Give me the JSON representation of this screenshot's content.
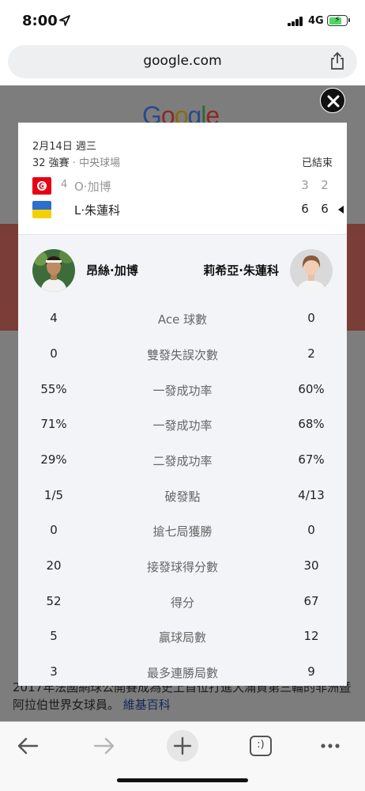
{
  "status_bar": {
    "time": "8:00",
    "network": "4G"
  },
  "browser": {
    "url": "google.com"
  },
  "background_page": {
    "logo": [
      "G",
      "o",
      "o",
      "g",
      "l",
      "e"
    ],
    "snippet_text": "2017年法國網球公開賽成為史上首位打進大滿貫第三輪的非洲暨阿拉伯世界女球員。",
    "snippet_link": "維基百科"
  },
  "match": {
    "date": "2月14日 週三",
    "round": "32 強賽",
    "separator": "·",
    "court": "中央球場",
    "status": "已結束",
    "players": [
      {
        "seed": "4",
        "name": "O·加博",
        "sets": [
          "3",
          "2"
        ],
        "flag": "tunisia",
        "winner": false
      },
      {
        "seed": "",
        "name": "L·朱蓮科",
        "sets": [
          "6",
          "6"
        ],
        "flag": "ukraine",
        "winner": true
      }
    ]
  },
  "stats": {
    "player1_name": "昂絲·加博",
    "player2_name": "莉希亞·朱蓮科",
    "rows": [
      {
        "p1": "4",
        "label": "Ace 球數",
        "p2": "0"
      },
      {
        "p1": "0",
        "label": "雙發失誤次數",
        "p2": "2"
      },
      {
        "p1": "55%",
        "label": "一發成功率",
        "p2": "60%"
      },
      {
        "p1": "71%",
        "label": "一發成功率",
        "p2": "68%"
      },
      {
        "p1": "29%",
        "label": "二發成功率",
        "p2": "67%"
      },
      {
        "p1": "1/5",
        "label": "破發點",
        "p2": "4/13"
      },
      {
        "p1": "0",
        "label": "搶七局獲勝",
        "p2": "0"
      },
      {
        "p1": "20",
        "label": "接發球得分數",
        "p2": "30"
      },
      {
        "p1": "52",
        "label": "得分",
        "p2": "67"
      },
      {
        "p1": "5",
        "label": "贏球局數",
        "p2": "12"
      },
      {
        "p1": "3",
        "label": "最多連勝局數",
        "p2": "9"
      }
    ]
  },
  "toolbar": {
    "tabs_label": ":)"
  },
  "colors": {
    "tunisia_red": "#e70013",
    "ukraine_blue": "#2c6fd1",
    "ukraine_yellow": "#f5d000"
  }
}
